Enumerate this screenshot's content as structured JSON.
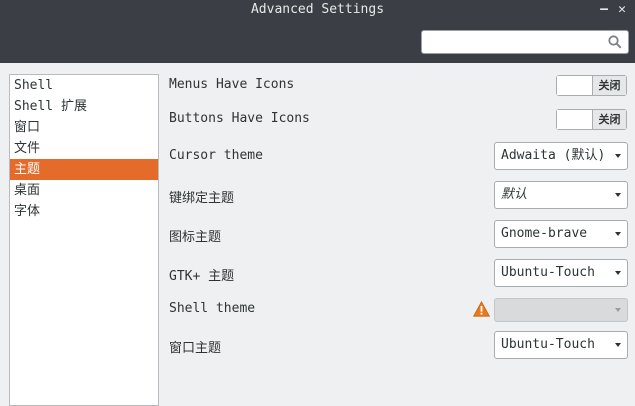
{
  "window": {
    "title": "Advanced Settings",
    "minimize_icon": "minimize-icon",
    "close_icon": "close-icon"
  },
  "header": {
    "search": {
      "placeholder": "",
      "value": "",
      "icon": "search-icon"
    }
  },
  "sidebar": {
    "items": [
      {
        "label": "Shell"
      },
      {
        "label": "Shell 扩展"
      },
      {
        "label": "窗口"
      },
      {
        "label": "文件"
      },
      {
        "label": "主题",
        "selected": true
      },
      {
        "label": "桌面"
      },
      {
        "label": "字体"
      }
    ]
  },
  "settings": {
    "menus_have_icons": {
      "label": "Menus Have Icons",
      "state": "关闭"
    },
    "buttons_have_icons": {
      "label": "Buttons Have Icons",
      "state": "关闭"
    },
    "cursor_theme": {
      "label": "Cursor theme",
      "value": "Adwaita (默认)"
    },
    "keybinding_theme": {
      "label": "键绑定主题",
      "value": "默认"
    },
    "icon_theme": {
      "label": "图标主题",
      "value": "Gnome-brave"
    },
    "gtk_theme": {
      "label": "GTK+ 主题",
      "value": "Ubuntu-Touch"
    },
    "shell_theme": {
      "label": "Shell theme",
      "value": "",
      "warning_icon": "warning-icon",
      "disabled": true
    },
    "window_theme": {
      "label": "窗口主题",
      "value": "Ubuntu-Touch"
    }
  },
  "colors": {
    "titlebar": "#3b3f45",
    "accent": "#e56b2b",
    "background": "#eff0f1",
    "warning": "#e97a1d"
  }
}
